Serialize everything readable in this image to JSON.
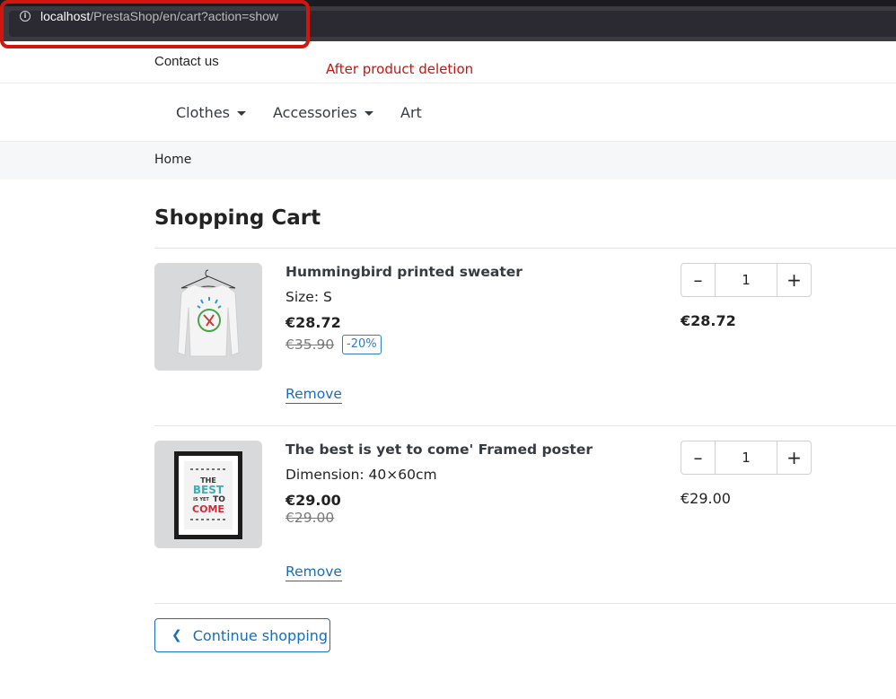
{
  "browser": {
    "url_host": "localhost",
    "url_path": "/PrestaShop/en/cart?action=show"
  },
  "annotation": {
    "note": "After product deletion"
  },
  "header": {
    "contact_label": "Contact us",
    "menu": [
      {
        "label": "Clothes"
      },
      {
        "label": "Accessories"
      },
      {
        "label": "Art"
      }
    ]
  },
  "breadcrumb": {
    "home": "Home"
  },
  "cart": {
    "title": "Shopping Cart",
    "items": [
      {
        "name": "Hummingbird printed sweater",
        "attribute": "Size: S",
        "price": "€28.72",
        "regular_price": "€35.90",
        "discount": "-20%",
        "remove_label": "Remove",
        "quantity": "1",
        "line_total": "€28.72"
      },
      {
        "name": "The best is yet to come' Framed poster",
        "attribute": "Dimension: 40×60cm",
        "price": "€29.00",
        "regular_price": "€29.00",
        "remove_label": "Remove",
        "quantity": "1",
        "line_total": "€29.00",
        "poster_text": [
          "THE",
          "BEST",
          "IS YET",
          "TO",
          "COME"
        ]
      }
    ],
    "continue_label": "Continue shopping"
  },
  "colors": {
    "accent_link": "#1a6dbb",
    "annotation_red": "#d2160e",
    "discount_blue": "#2f7dc4"
  }
}
